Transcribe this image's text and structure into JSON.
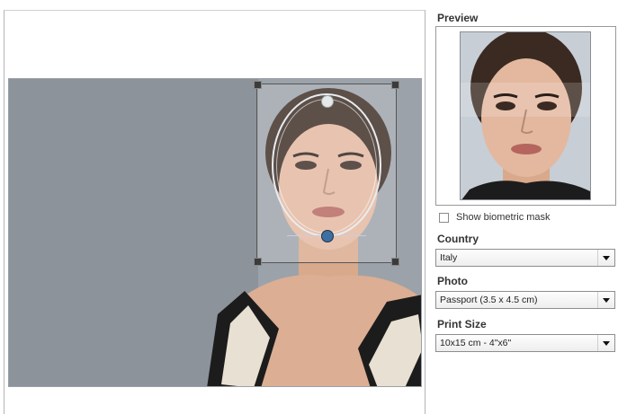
{
  "preview": {
    "label": "Preview"
  },
  "mask": {
    "label": "Show biometric mask",
    "checked": false
  },
  "country": {
    "label": "Country",
    "value": "Italy"
  },
  "photo": {
    "label": "Photo",
    "value": "Passport (3.5 x 4.5 cm)"
  },
  "print_size": {
    "label": "Print Size",
    "value": "10x15 cm - 4\"x6\""
  },
  "icons": {
    "dropdown": "chevron-down-icon",
    "crop_handle": "resize-handle-icon"
  },
  "colors": {
    "photo_background": "#8d939a",
    "crop_frame": "#555555",
    "chin_marker": "#3d6fa3"
  }
}
